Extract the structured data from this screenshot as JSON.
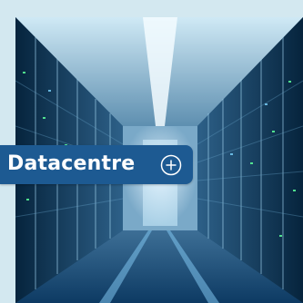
{
  "tile": {
    "label": "Datacentre",
    "expand_icon": "plus-circle-icon",
    "label_background": "#1d5a92",
    "photo_subject": "server-corridor-photo"
  }
}
